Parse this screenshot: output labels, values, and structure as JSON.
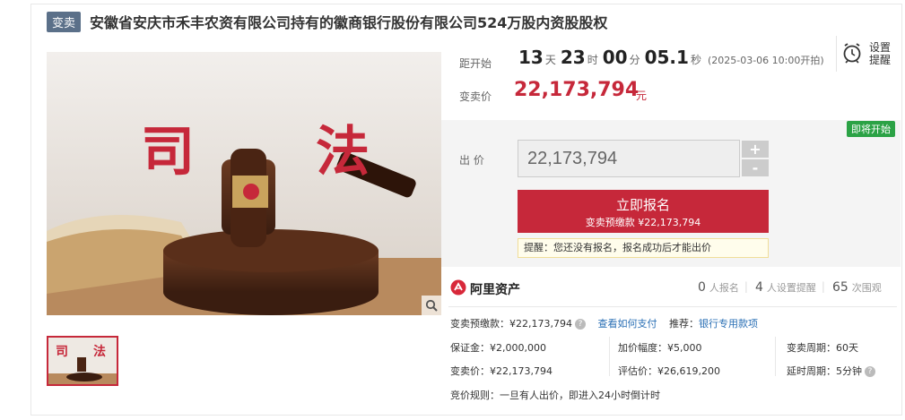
{
  "header": {
    "tag": "变卖",
    "title": "安徽省安庆市禾丰农资有限公司持有的徽商银行股份有限公司524万股内资股股权"
  },
  "hero": {
    "char1": "司",
    "char2": "法"
  },
  "countdown": {
    "label": "距开始",
    "days": "13",
    "days_unit": "天",
    "hours": "23",
    "hours_unit": "时",
    "minutes": "00",
    "minutes_unit": "分",
    "seconds": "05.1",
    "seconds_unit": "秒",
    "start_note": "(2025-03-06 10:00开拍)"
  },
  "reminder": {
    "label": "设置提醒"
  },
  "sale_price": {
    "label": "变卖价",
    "value": "22,173,794",
    "unit": "元"
  },
  "status_badge": "即将开始",
  "bid": {
    "label": "出 价",
    "value": "22,173,794",
    "plus": "+",
    "minus": "-"
  },
  "signup": {
    "title": "立即报名",
    "subtitle": "变卖预缴款 ¥22,173,794"
  },
  "tip": "提醒：您还没有报名，报名成功后才能出价",
  "platform": {
    "name": "阿里资产"
  },
  "stats": [
    {
      "n": "0",
      "u": "人报名"
    },
    {
      "n": "4",
      "u": "人设置提醒"
    },
    {
      "n": "65",
      "u": "次围观"
    }
  ],
  "details": {
    "deposit": "变卖预缴款：¥22,173,794",
    "how_to_pay": "查看如何支付",
    "recommend_label": "推荐：",
    "recommend_link": "银行专用款项",
    "margin": "保证金：¥2,000,000",
    "increment": "加价幅度：¥5,000",
    "cycle": "变卖周期：60天",
    "sale_price": "变卖价：¥22,173,794",
    "assessed": "评估价：¥26,619,200",
    "delay": "延时周期：5分钟",
    "rule": "竞价规则：一旦有人出价，即进入24小时倒计时"
  },
  "colors": {
    "accent": "#c6283a",
    "tag_bg": "#5b7089",
    "badge_green": "#2ba245",
    "link": "#2a6fb5"
  }
}
